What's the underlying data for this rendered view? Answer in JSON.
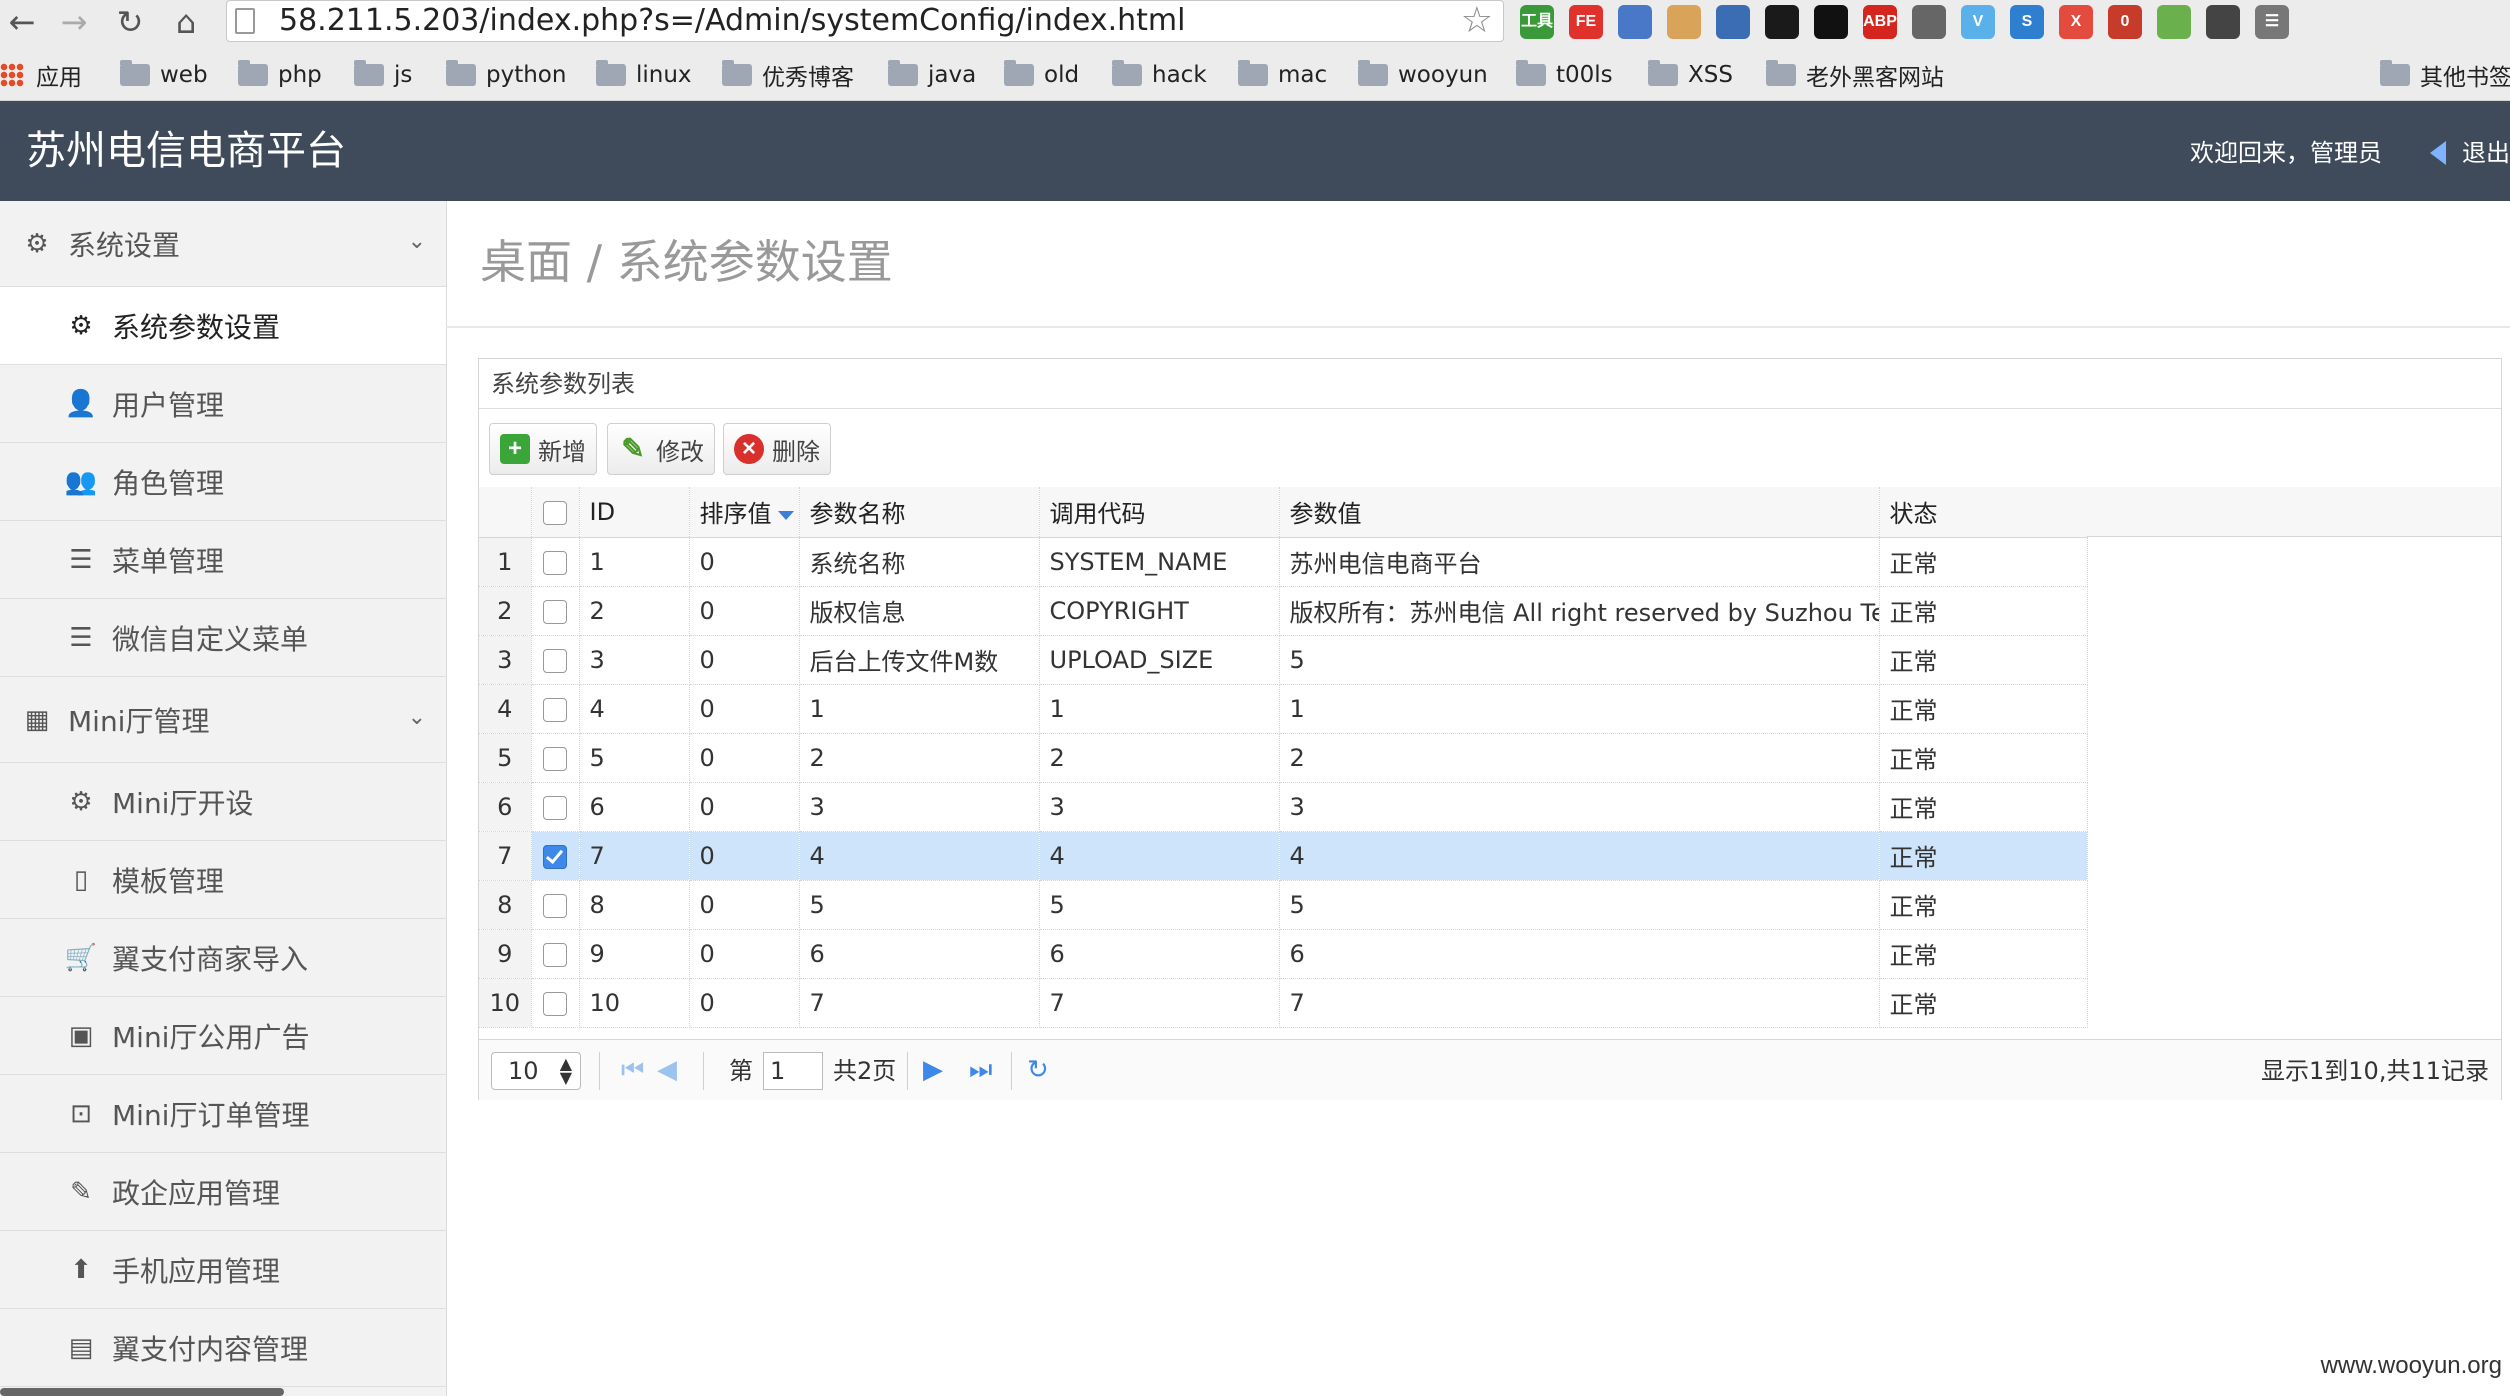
{
  "browser": {
    "url": "58.211.5.203/index.php?s=/Admin/systemConfig/index.html",
    "back_glyph": "←",
    "forward_glyph": "→",
    "reload_glyph": "↻",
    "home_glyph": "⌂",
    "star_glyph": "☆",
    "extensions": [
      {
        "icon": "dev-tools-icon",
        "text": "工具",
        "color": "#3a9a3a"
      },
      {
        "icon": "fe-icon",
        "text": "FE",
        "color": "#e0312d"
      },
      {
        "icon": "globe-icon",
        "text": "",
        "color": "#4a78c8"
      },
      {
        "icon": "cookie-icon",
        "text": "",
        "color": "#d9a35a"
      },
      {
        "icon": "cloud-icon",
        "text": "",
        "color": "#3b6db5"
      },
      {
        "icon": "eye-icon",
        "text": "",
        "color": "#1a1a1a"
      },
      {
        "icon": "circle-icon",
        "text": "",
        "color": "#111111"
      },
      {
        "icon": "abp-icon",
        "text": "ABP",
        "color": "#d4261f"
      },
      {
        "icon": "evernote-icon",
        "text": "",
        "color": "#666666"
      },
      {
        "icon": "v-icon",
        "text": "V",
        "color": "#5ab0e8"
      },
      {
        "icon": "s-icon",
        "text": "S",
        "color": "#2f7fd1"
      },
      {
        "icon": "x-icon",
        "text": "X",
        "color": "#e34b3f"
      },
      {
        "icon": "badge-icon",
        "text": "0",
        "color": "#c63b2a"
      },
      {
        "icon": "tag-icon",
        "text": "",
        "color": "#6ab04c"
      },
      {
        "icon": "spider-icon",
        "text": "",
        "color": "#444444"
      },
      {
        "icon": "menu-icon",
        "text": "☰",
        "color": "#777777"
      }
    ],
    "bookmarks": [
      {
        "label": "应用",
        "type": "apps"
      },
      {
        "label": "web",
        "type": "folder"
      },
      {
        "label": "php",
        "type": "folder"
      },
      {
        "label": "js",
        "type": "folder"
      },
      {
        "label": "python",
        "type": "folder"
      },
      {
        "label": "linux",
        "type": "folder"
      },
      {
        "label": "优秀博客",
        "type": "folder"
      },
      {
        "label": "java",
        "type": "folder"
      },
      {
        "label": "old",
        "type": "folder"
      },
      {
        "label": "hack",
        "type": "folder"
      },
      {
        "label": "mac",
        "type": "folder"
      },
      {
        "label": "wooyun",
        "type": "folder"
      },
      {
        "label": "t00ls",
        "type": "folder"
      },
      {
        "label": "XSS",
        "type": "folder"
      },
      {
        "label": "老外黑客网站",
        "type": "folder"
      },
      {
        "label": "其他书签",
        "type": "folder"
      }
    ]
  },
  "header": {
    "title": "苏州电信电商平台",
    "welcome": "欢迎回来，管理员",
    "logout": "退出"
  },
  "sidebar": {
    "items": [
      {
        "label": "系统设置",
        "icon": "gear-icon",
        "glyph": "⚙",
        "kind": "group"
      },
      {
        "label": "系统参数设置",
        "icon": "gears-icon",
        "glyph": "⚙",
        "kind": "active"
      },
      {
        "label": "用户管理",
        "icon": "user-icon",
        "glyph": "👤",
        "kind": "item"
      },
      {
        "label": "角色管理",
        "icon": "users-icon",
        "glyph": "👥",
        "kind": "item"
      },
      {
        "label": "菜单管理",
        "icon": "list-icon",
        "glyph": "☰",
        "kind": "item"
      },
      {
        "label": "微信自定义菜单",
        "icon": "list-icon",
        "glyph": "☰",
        "kind": "item"
      },
      {
        "label": "Mini厅管理",
        "icon": "building-icon",
        "glyph": "▦",
        "kind": "group"
      },
      {
        "label": "Mini厅开设",
        "icon": "cog-icon",
        "glyph": "⚙",
        "kind": "item"
      },
      {
        "label": "模板管理",
        "icon": "file-icon",
        "glyph": "▯",
        "kind": "item"
      },
      {
        "label": "翼支付商家导入",
        "icon": "cart-icon",
        "glyph": "🛒",
        "kind": "item"
      },
      {
        "label": "Mini厅公用广告",
        "icon": "picture-icon",
        "glyph": "▣",
        "kind": "item"
      },
      {
        "label": "Mini厅订单管理",
        "icon": "money-icon",
        "glyph": "⊡",
        "kind": "item"
      },
      {
        "label": "政企应用管理",
        "icon": "wrench-icon",
        "glyph": "✎",
        "kind": "item"
      },
      {
        "label": "手机应用管理",
        "icon": "upload-circle-icon",
        "glyph": "⬆",
        "kind": "item"
      },
      {
        "label": "翼支付内容管理",
        "icon": "document-icon",
        "glyph": "▤",
        "kind": "item"
      }
    ],
    "chevron_glyph": "⌄"
  },
  "main": {
    "page_title": "桌面 / 系统参数设置",
    "panel_title": "系统参数列表",
    "toolbar": {
      "add": "新增",
      "edit": "修改",
      "delete": "删除"
    },
    "columns": [
      "",
      "",
      "ID",
      "排序值",
      "参数名称",
      "调用代码",
      "参数值",
      "状态"
    ],
    "rows": [
      {
        "n": "1",
        "checked": false,
        "id": "1",
        "sort": "0",
        "name": "系统名称",
        "code": "SYSTEM_NAME",
        "value": "苏州电信电商平台",
        "status": "正常"
      },
      {
        "n": "2",
        "checked": false,
        "id": "2",
        "sort": "0",
        "name": "版权信息",
        "code": "COPYRIGHT",
        "value": "版权所有：苏州电信 All right reserved by Suzhou Telec",
        "status": "正常"
      },
      {
        "n": "3",
        "checked": false,
        "id": "3",
        "sort": "0",
        "name": "后台上传文件M数",
        "code": "UPLOAD_SIZE",
        "value": "5",
        "status": "正常"
      },
      {
        "n": "4",
        "checked": false,
        "id": "4",
        "sort": "0",
        "name": "1",
        "code": "1",
        "value": "1",
        "status": "正常"
      },
      {
        "n": "5",
        "checked": false,
        "id": "5",
        "sort": "0",
        "name": "2",
        "code": "2",
        "value": "2",
        "status": "正常"
      },
      {
        "n": "6",
        "checked": false,
        "id": "6",
        "sort": "0",
        "name": "3",
        "code": "3",
        "value": "3",
        "status": "正常"
      },
      {
        "n": "7",
        "checked": true,
        "id": "7",
        "sort": "0",
        "name": "4",
        "code": "4",
        "value": "4",
        "status": "正常"
      },
      {
        "n": "8",
        "checked": false,
        "id": "8",
        "sort": "0",
        "name": "5",
        "code": "5",
        "value": "5",
        "status": "正常"
      },
      {
        "n": "9",
        "checked": false,
        "id": "9",
        "sort": "0",
        "name": "6",
        "code": "6",
        "value": "6",
        "status": "正常"
      },
      {
        "n": "10",
        "checked": false,
        "id": "10",
        "sort": "0",
        "name": "7",
        "code": "7",
        "value": "7",
        "status": "正常"
      }
    ],
    "pager": {
      "page_size": "10",
      "page_prefix": "第",
      "page_value": "1",
      "page_total": "共2页",
      "info": "显示1到10,共11记录"
    }
  },
  "watermark": "www.wooyun.org",
  "colors": {
    "header_bg": "#3f4b5b",
    "selected_row": "#cde4fb",
    "accent_blue": "#3d88e8"
  }
}
